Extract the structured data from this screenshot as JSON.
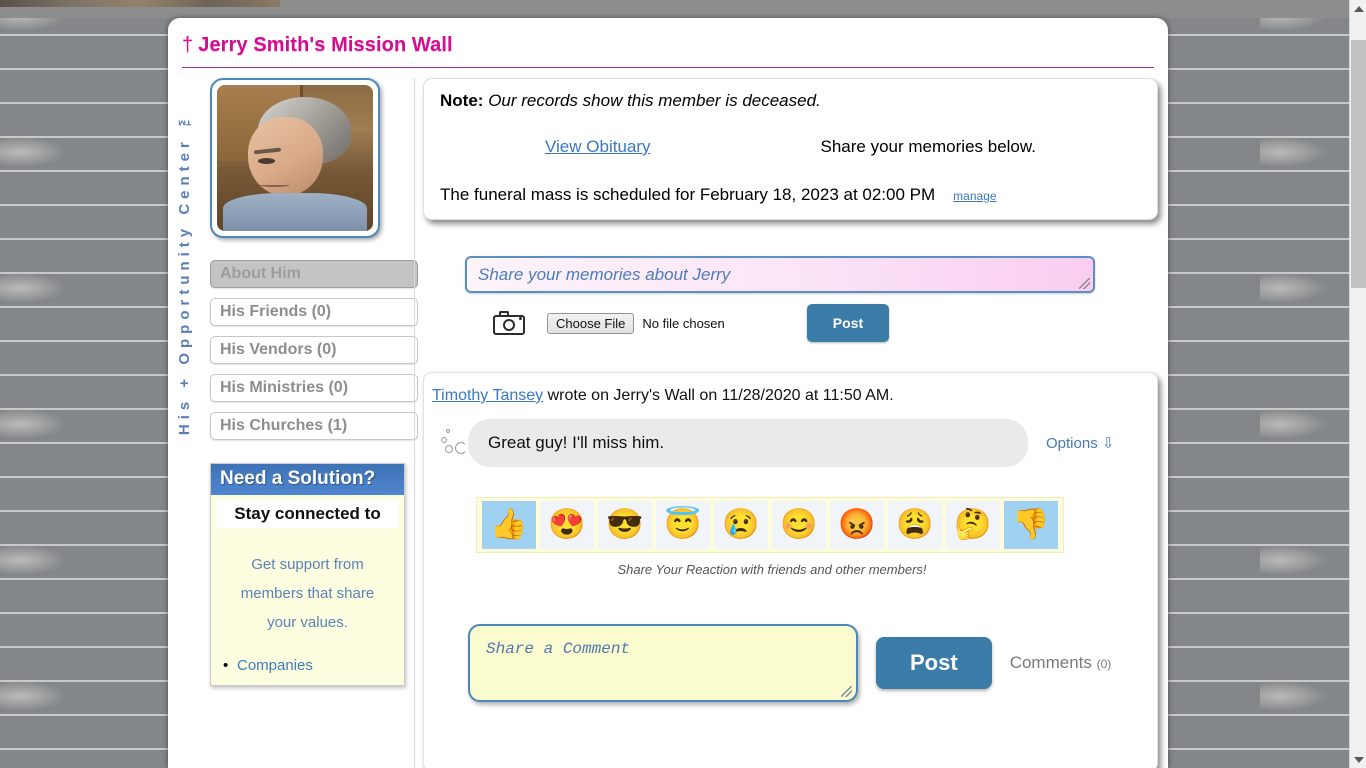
{
  "page": {
    "title": "Jerry Smith's Mission Wall",
    "cross_symbol": "†",
    "brand_vertical": "His + Opportunity Center ™",
    "accent_color": "#d40d8f",
    "link_color": "#3b78c4",
    "button_color": "#3a7ba8"
  },
  "sidebar": {
    "avatar_alt": "Jerry Smith profile photo",
    "nav_items": [
      {
        "label": "About Him",
        "active": true
      },
      {
        "label": "His Friends (0)",
        "active": false
      },
      {
        "label": "His Vendors (0)",
        "active": false
      },
      {
        "label": "His Ministries (0)",
        "active": false
      },
      {
        "label": "His Churches (1)",
        "active": false
      }
    ],
    "solution": {
      "heading": "Need a Solution?",
      "subheading": "Stay connected to",
      "body": "Get support from members that share your values.",
      "list": [
        "Companies"
      ]
    }
  },
  "note": {
    "label": "Note:",
    "message": "Our records show this member is deceased.",
    "obituary_link": "View Obituary",
    "share_prompt": "Share your memories below.",
    "funeral_text": "The funeral mass is scheduled for February 18, 2023 at 02:00 PM",
    "manage_link": "manage"
  },
  "composer": {
    "placeholder": "Share your memories about Jerry",
    "value": "",
    "camera_icon": "camera-icon",
    "choose_file_label": "Choose File",
    "no_file_text": "No file chosen",
    "post_label": "Post"
  },
  "post": {
    "author": "Timothy Tansey",
    "meta": " wrote on Jerry's Wall on 11/28/2020 at 11:50 AM.",
    "body": "Great guy! I'll miss him.",
    "options_label": "Options ⇩",
    "reactions": [
      {
        "name": "thumbs-up-reaction",
        "glyph": "👍",
        "selected": true
      },
      {
        "name": "heart-eyes-reaction",
        "glyph": "😍",
        "selected": false
      },
      {
        "name": "sunglasses-reaction",
        "glyph": "😎",
        "selected": false
      },
      {
        "name": "halo-reaction",
        "glyph": "😇",
        "selected": false
      },
      {
        "name": "crying-reaction",
        "glyph": "😢",
        "selected": false
      },
      {
        "name": "smiling-reaction",
        "glyph": "😊",
        "selected": false
      },
      {
        "name": "angry-reaction",
        "glyph": "😡",
        "selected": false
      },
      {
        "name": "weary-reaction",
        "glyph": "😩",
        "selected": false
      },
      {
        "name": "thinking-reaction",
        "glyph": "🤔",
        "selected": false
      },
      {
        "name": "thumbs-down-reaction",
        "glyph": "👎",
        "selected": true
      }
    ],
    "reaction_caption": "Share Your Reaction with friends and other members!",
    "comment_placeholder": "Share a Comment",
    "comment_value": "",
    "comment_post_label": "Post",
    "comments_label": "Comments",
    "comments_count": "(0)"
  }
}
